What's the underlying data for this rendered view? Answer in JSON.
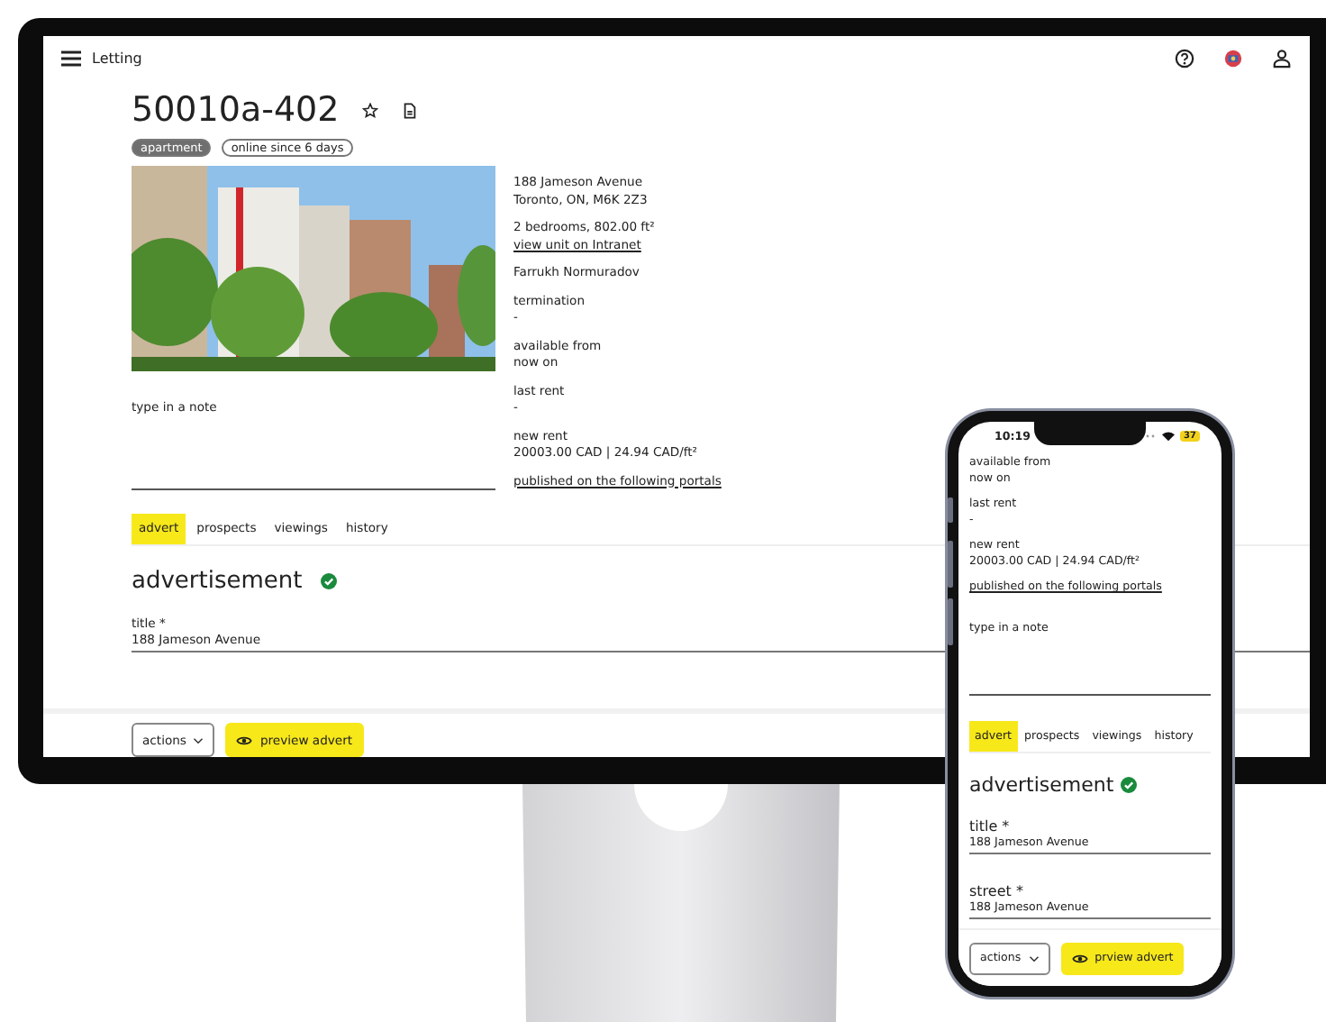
{
  "monitor": {
    "app_bar": {
      "title": "Letting"
    },
    "listing": {
      "title": "50010a-402",
      "badges": [
        {
          "label": "apartment",
          "kind": "filled"
        },
        {
          "label": "online since 6 days",
          "kind": "outlined"
        }
      ],
      "details": [
        {
          "lines": [
            "188 Jameson Avenue",
            "Toronto, ON, M6K 2Z3"
          ]
        },
        {
          "lines": [
            "2 bedrooms, 802.00 ft²"
          ],
          "link": "view unit on Intranet"
        },
        {
          "lines": [
            "Farrukh Normuradov"
          ]
        },
        {
          "lines": [
            "termination",
            "-"
          ]
        },
        {
          "lines": [
            "available from",
            "now on"
          ]
        },
        {
          "lines": [
            "last rent",
            "-"
          ]
        },
        {
          "lines": [
            "new rent",
            "20003.00 CAD | 24.94 CAD/ft²"
          ]
        }
      ],
      "portals_link": "published on the following portals",
      "note": {
        "placeholder": "type in a note"
      }
    },
    "tabs": [
      {
        "label": "advert",
        "selected": true
      },
      {
        "label": "prospects",
        "selected": false
      },
      {
        "label": "viewings",
        "selected": false
      },
      {
        "label": "history",
        "selected": false
      }
    ],
    "section": {
      "title": "advertisement",
      "complete": true
    },
    "fields": [
      {
        "label": "title *",
        "value": "188 Jameson Avenue"
      }
    ],
    "buttons": [
      {
        "label": "actions",
        "kind": "dropdown"
      },
      {
        "label": "preview advert",
        "kind": "primary"
      }
    ]
  },
  "phone": {
    "status_bar": {
      "time": "10:19",
      "battery": "37"
    },
    "details": [
      {
        "lines": [
          "available from",
          "now on"
        ]
      },
      {
        "lines": [
          "last rent",
          "-"
        ]
      },
      {
        "lines": [
          "new rent",
          "20003.00 CAD | 24.94 CAD/ft²"
        ]
      }
    ],
    "portals_link": "published on the following portals",
    "note": {
      "placeholder": "type in a note"
    },
    "tabs": [
      {
        "label": "advert",
        "selected": true
      },
      {
        "label": "prospects",
        "selected": false
      },
      {
        "label": "viewings",
        "selected": false
      },
      {
        "label": "history",
        "selected": false
      }
    ],
    "section": {
      "title": "advertisement",
      "complete": true
    },
    "fields": [
      {
        "label": "title *",
        "value": "188 Jameson Avenue"
      },
      {
        "label": "street *",
        "value": "188 Jameson Avenue"
      }
    ],
    "buttons": [
      {
        "label": "actions",
        "kind": "dropdown"
      },
      {
        "label": "prview advert",
        "kind": "primary"
      }
    ]
  }
}
